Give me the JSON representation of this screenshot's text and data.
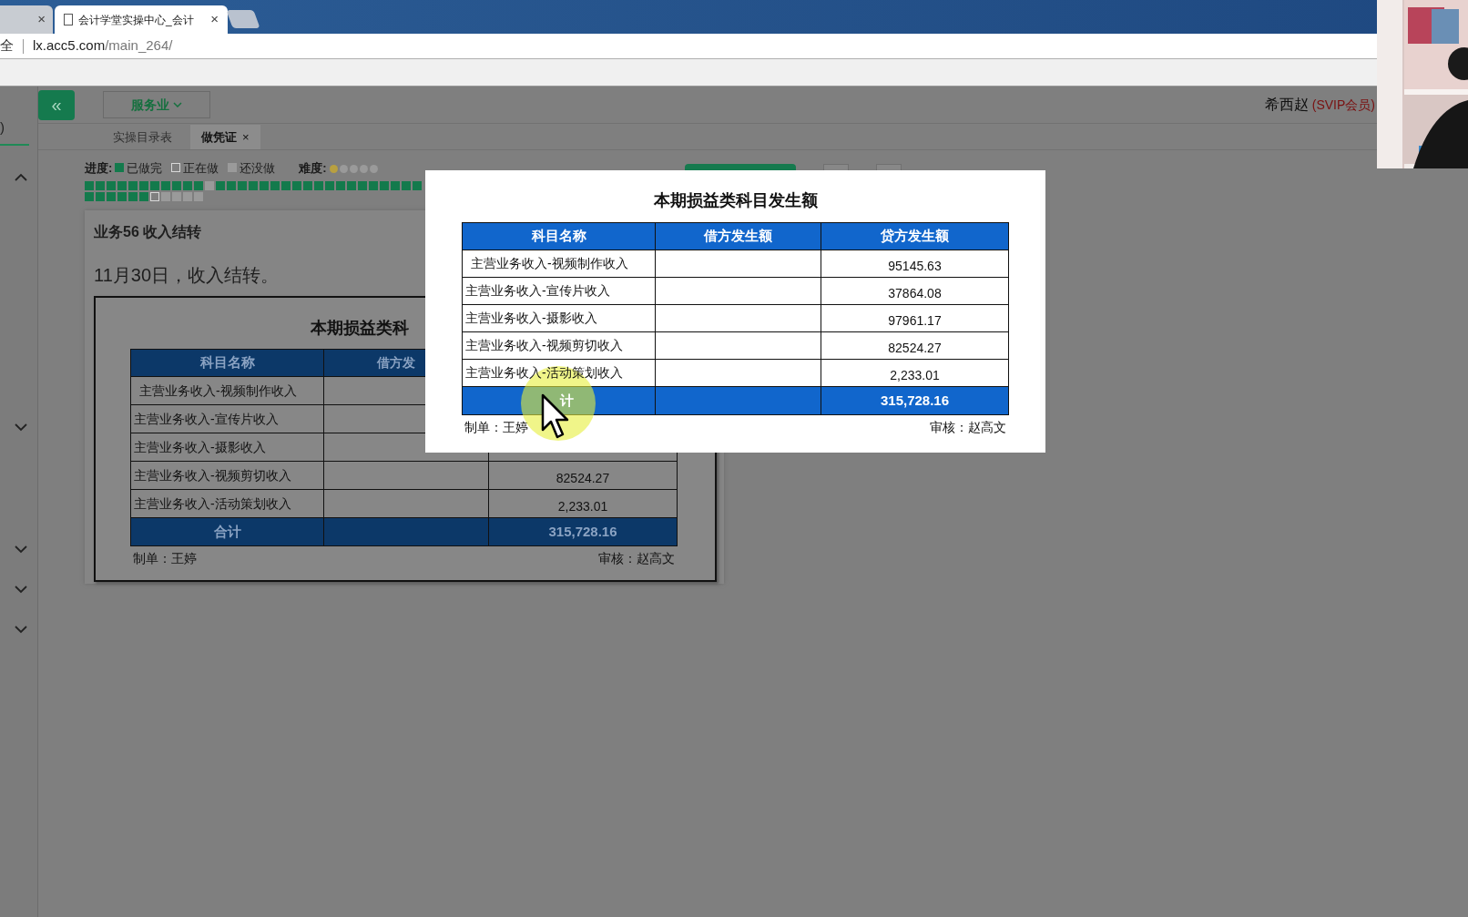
{
  "browser": {
    "tabs": [
      {
        "close": "×",
        "selected": false
      },
      {
        "title": "会计学堂实操中心_会计",
        "close": "×",
        "selected": true
      }
    ],
    "address": {
      "security": "全",
      "host": "lx.acc5.com",
      "path": "/main_264/"
    }
  },
  "sidebar": {
    "label": ")",
    "chevrons": [
      {
        "expanded": true
      },
      {
        "expanded": false
      },
      {
        "expanded": false
      },
      {
        "expanded": false
      },
      {
        "expanded": false
      }
    ]
  },
  "header": {
    "collapse": "«",
    "industry": "服务业",
    "user": "希西赵",
    "membership": "(SVIP会员)"
  },
  "page_tabs": [
    {
      "label": "实操目录表",
      "selected": false
    },
    {
      "label": "做凭证",
      "close": "×",
      "selected": true
    }
  ],
  "progress": {
    "label": "进度:",
    "legend": [
      {
        "kind": "done",
        "label": "已做完"
      },
      {
        "kind": "doing",
        "label": "正在做"
      },
      {
        "kind": "todo",
        "label": "还没做"
      }
    ],
    "difficulty_label": "难度:",
    "stars": 1,
    "rows": [
      [
        {
          "kind": "done"
        },
        {
          "kind": "done"
        },
        {
          "kind": "done"
        },
        {
          "kind": "done"
        },
        {
          "kind": "done"
        },
        {
          "kind": "done"
        },
        {
          "kind": "done"
        },
        {
          "kind": "done"
        },
        {
          "kind": "done"
        },
        {
          "kind": "done"
        },
        {
          "kind": "done"
        },
        {
          "kind": "todo"
        },
        {
          "kind": "done"
        },
        {
          "kind": "done"
        },
        {
          "kind": "done"
        },
        {
          "kind": "done"
        },
        {
          "kind": "done"
        },
        {
          "kind": "done"
        },
        {
          "kind": "done"
        },
        {
          "kind": "done"
        },
        {
          "kind": "done"
        },
        {
          "kind": "done"
        },
        {
          "kind": "done"
        },
        {
          "kind": "done"
        },
        {
          "kind": "done"
        },
        {
          "kind": "done"
        },
        {
          "kind": "done"
        },
        {
          "kind": "done"
        },
        {
          "kind": "done"
        },
        {
          "kind": "done"
        },
        {
          "kind": "done"
        }
      ],
      [
        {
          "kind": "done"
        },
        {
          "kind": "done"
        },
        {
          "kind": "done"
        },
        {
          "kind": "done"
        },
        {
          "kind": "done"
        },
        {
          "kind": "done"
        },
        {
          "kind": "doing"
        },
        {
          "kind": "todo"
        },
        {
          "kind": "todo"
        },
        {
          "kind": "todo"
        },
        {
          "kind": "todo"
        }
      ]
    ]
  },
  "task": {
    "title": "业务56 收入结转",
    "description": "11月30日，收入结转。",
    "sheet": {
      "title": "本期损益类科",
      "columns": [
        "科目名称",
        "借方发"
      ],
      "rows": [
        {
          "account": "主营业务收入-视频制作收入"
        },
        {
          "account": "主营业务收入-宣传片收入"
        },
        {
          "account": "主营业务收入-摄影收入"
        },
        {
          "account": "主营业务收入-视频剪切收入",
          "credit": "82524.27"
        },
        {
          "account": "主营业务收入-活动策划收入",
          "credit": "2,233.01"
        }
      ],
      "total": {
        "label": "合计",
        "credit": "315,728.16"
      },
      "prepared_by": "制单：王婷",
      "reviewed_by": "审核：赵高文"
    }
  },
  "popup": {
    "title": "本期损益类科目发生额",
    "columns": [
      "科目名称",
      "借方发生额",
      "贷方发生额"
    ],
    "rows": [
      {
        "account": "主营业务收入-视频制作收入",
        "credit": "95145.63"
      },
      {
        "account": "主营业务收入-宣传片收入",
        "credit": "37864.08"
      },
      {
        "account": "主营业务收入-摄影收入",
        "credit": "97961.17"
      },
      {
        "account": "主营业务收入-视频剪切收入",
        "credit": "82524.27"
      },
      {
        "account": "主营业务收入-活动策划收入",
        "credit": "2,233.01"
      }
    ],
    "total": {
      "label": "计",
      "credit": "315,728.16"
    },
    "prepared_by": "制单：王婷",
    "reviewed_by": "审核：赵高文"
  }
}
